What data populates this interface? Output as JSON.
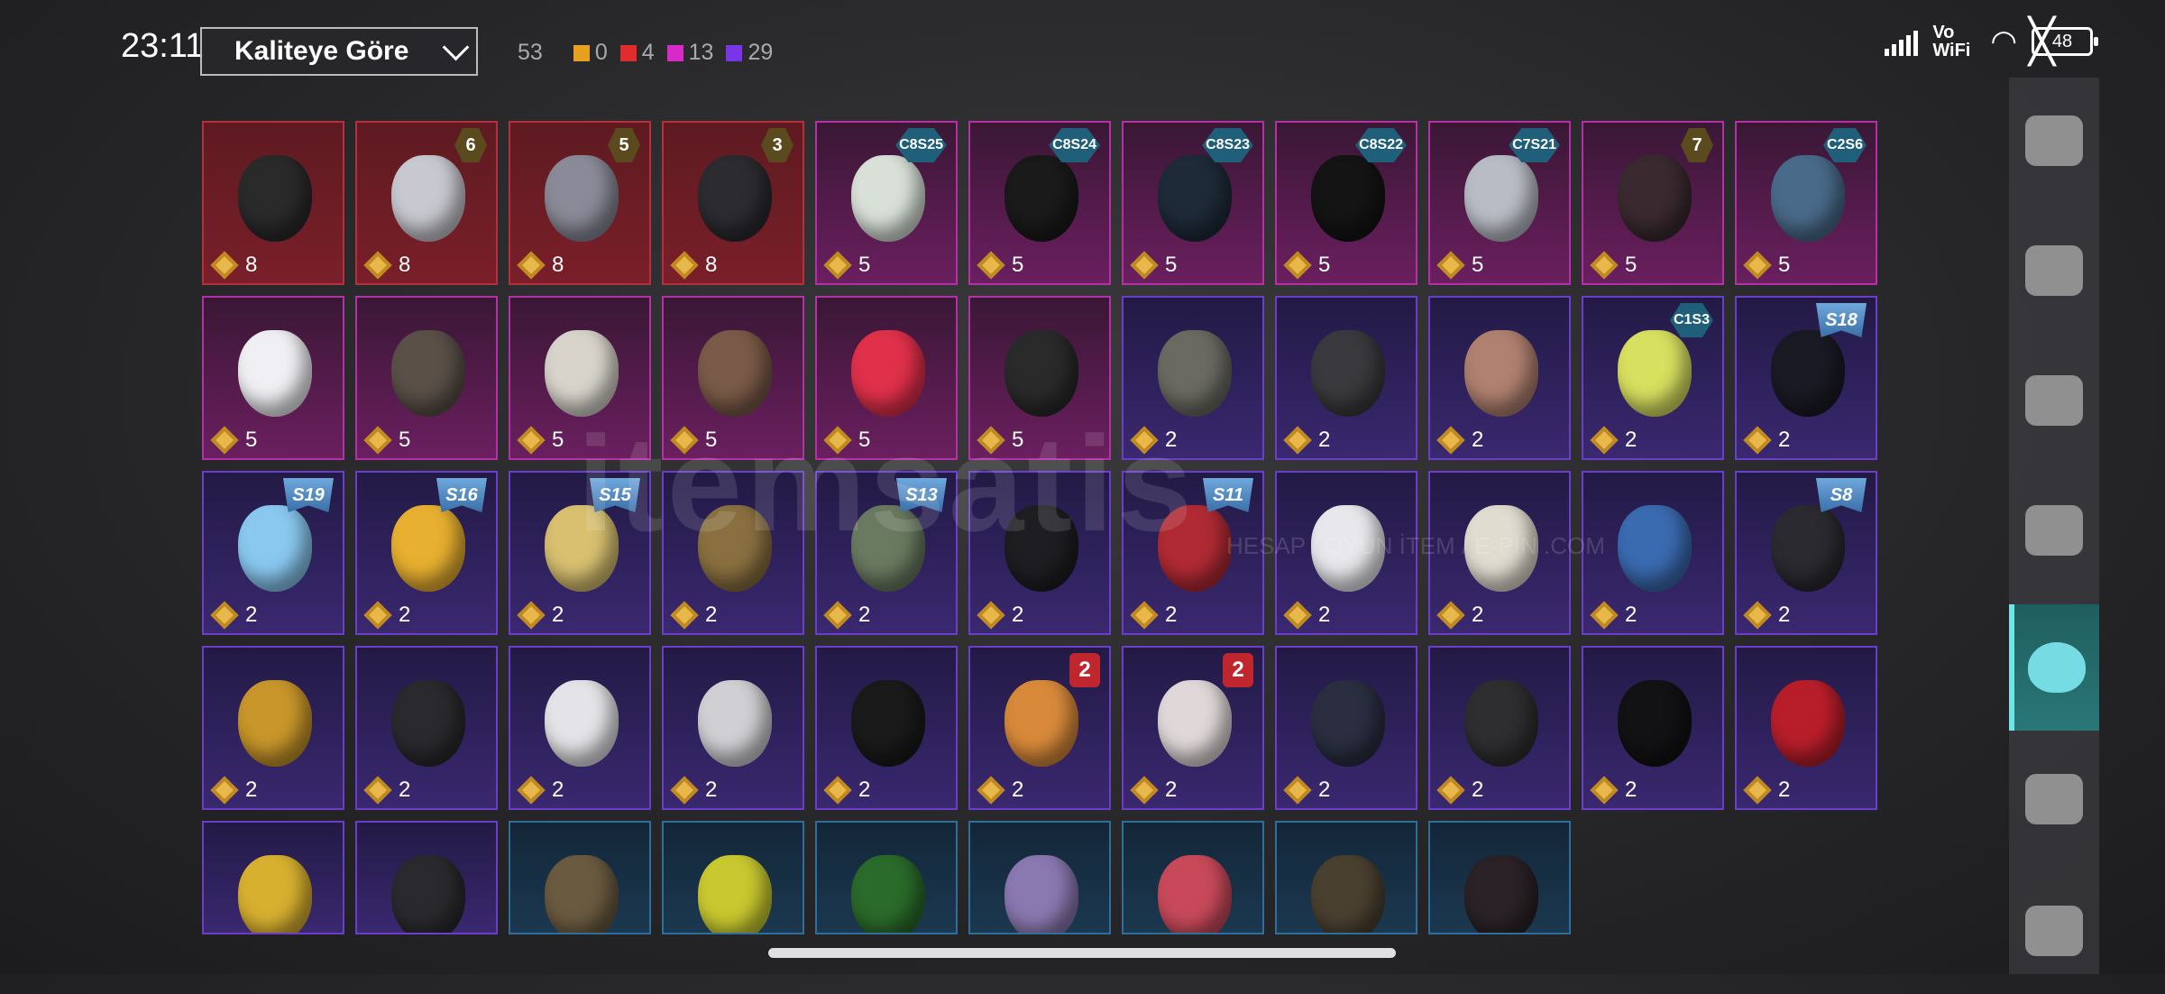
{
  "status_bar": {
    "time": "23:11",
    "network": "Vo WiFi",
    "battery": "48"
  },
  "sort": {
    "label": "Kaliteye Göre"
  },
  "counts": {
    "total": "53",
    "items": [
      {
        "color": "#e8a021",
        "value": "0"
      },
      {
        "color": "#e02c2c",
        "value": "4"
      },
      {
        "color": "#d62bc8",
        "value": "13"
      },
      {
        "color": "#7a35e8",
        "value": "29"
      }
    ]
  },
  "watermark": {
    "main": "itemsatis",
    "sub": "HESAP / OYUN İTEM / E-PIN .COM"
  },
  "items": [
    {
      "rarity": "red",
      "value": "8",
      "badge": "",
      "badge_type": "",
      "icon": "cyber-mask-icon",
      "color": "#2a2a2a"
    },
    {
      "rarity": "red",
      "value": "8",
      "badge": "6",
      "badge_type": "lvl",
      "icon": "plague-doctor-mask-icon",
      "color": "#c8c8d0"
    },
    {
      "rarity": "red",
      "value": "8",
      "badge": "5",
      "badge_type": "lvl",
      "icon": "gas-mask-icon",
      "color": "#8a8a98"
    },
    {
      "rarity": "red",
      "value": "8",
      "badge": "3",
      "badge_type": "lvl",
      "icon": "wolf-mask-icon",
      "color": "#2b2b30"
    },
    {
      "rarity": "pink",
      "value": "5",
      "badge": "C8S25",
      "badge_type": "season",
      "icon": "book-mask-icon",
      "color": "#d8e0d8"
    },
    {
      "rarity": "pink",
      "value": "5",
      "badge": "C8S24",
      "badge_type": "season",
      "icon": "yellow-goggles-icon",
      "color": "#1a1a1a"
    },
    {
      "rarity": "pink",
      "value": "5",
      "badge": "C8S23",
      "badge_type": "season",
      "icon": "neon-face-mask-icon",
      "color": "#1e2a38"
    },
    {
      "rarity": "pink",
      "value": "5",
      "badge": "C8S22",
      "badge_type": "season",
      "icon": "black-face-mask-icon",
      "color": "#141414"
    },
    {
      "rarity": "pink",
      "value": "5",
      "badge": "C7S21",
      "badge_type": "season",
      "icon": "robot-mask-icon",
      "color": "#b8bcc4"
    },
    {
      "rarity": "pink",
      "value": "5",
      "badge": "7",
      "badge_type": "lvl",
      "icon": "wire-mask-icon",
      "color": "#3a2a30"
    },
    {
      "rarity": "pink",
      "value": "5",
      "badge": "C2S6",
      "badge_type": "season",
      "icon": "camo-mask-icon",
      "color": "#4a6a8a"
    },
    {
      "rarity": "pink",
      "value": "5",
      "badge": "",
      "badge_type": "",
      "icon": "clown-mask-icon",
      "color": "#f0f0f4"
    },
    {
      "rarity": "pink",
      "value": "5",
      "badge": "",
      "badge_type": "",
      "icon": "horned-respirator-icon",
      "color": "#5a5048"
    },
    {
      "rarity": "pink",
      "value": "5",
      "badge": "",
      "badge_type": "",
      "icon": "skull-mask-icon",
      "color": "#d8d4cc"
    },
    {
      "rarity": "pink",
      "value": "5",
      "badge": "",
      "badge_type": "",
      "icon": "bird-mask-icon",
      "color": "#7a5a48"
    },
    {
      "rarity": "pink",
      "value": "5",
      "badge": "",
      "badge_type": "",
      "icon": "clown-nose-icon",
      "color": "#e0304a"
    },
    {
      "rarity": "pink",
      "value": "5",
      "badge": "",
      "badge_type": "",
      "icon": "bandana-icon",
      "color": "#2a2a2a"
    },
    {
      "rarity": "purple",
      "value": "2",
      "badge": "",
      "badge_type": "",
      "icon": "hockey-mask-icon",
      "color": "#6a6a62"
    },
    {
      "rarity": "purple",
      "value": "2",
      "badge": "",
      "badge_type": "",
      "icon": "red-eye-visor-icon",
      "color": "#3a3a3e"
    },
    {
      "rarity": "purple",
      "value": "2",
      "badge": "",
      "badge_type": "",
      "icon": "mammoth-mask-icon",
      "color": "#b08070"
    },
    {
      "rarity": "purple",
      "value": "2",
      "badge": "C1S3",
      "badge_type": "season",
      "icon": "green-cross-mask-icon",
      "color": "#d8e060"
    },
    {
      "rarity": "purple",
      "value": "2",
      "badge": "S18",
      "badge_type": "s",
      "icon": "neon-black-mask-icon",
      "color": "#1a1a24"
    },
    {
      "rarity": "purple",
      "value": "2",
      "badge": "S19",
      "badge_type": "s",
      "icon": "crystal-visor-icon",
      "color": "#8ac8f0"
    },
    {
      "rarity": "purple",
      "value": "2",
      "badge": "S16",
      "badge_type": "s",
      "icon": "yellow-respirator-icon",
      "color": "#e8b030"
    },
    {
      "rarity": "purple",
      "value": "2",
      "badge": "S15",
      "badge_type": "s",
      "icon": "gold-skull-mask-icon",
      "color": "#d8c070"
    },
    {
      "rarity": "purple",
      "value": "2",
      "badge": "",
      "badge_type": "",
      "icon": "brass-mask-icon",
      "color": "#8a7040"
    },
    {
      "rarity": "purple",
      "value": "2",
      "badge": "S13",
      "badge_type": "s",
      "icon": "pilot-goggles-icon",
      "color": "#6a7a60"
    },
    {
      "rarity": "purple",
      "value": "2",
      "badge": "",
      "badge_type": "",
      "icon": "black-half-mask-icon",
      "color": "#1e1e22"
    },
    {
      "rarity": "purple",
      "value": "2",
      "badge": "S11",
      "badge_type": "s",
      "icon": "red-half-mask-icon",
      "color": "#b02a34"
    },
    {
      "rarity": "purple",
      "value": "2",
      "badge": "",
      "badge_type": "",
      "icon": "clown-face-icon",
      "color": "#e8e8ec"
    },
    {
      "rarity": "purple",
      "value": "2",
      "badge": "",
      "badge_type": "",
      "icon": "white-bandana-icon",
      "color": "#e0dcd0"
    },
    {
      "rarity": "purple",
      "value": "2",
      "badge": "",
      "badge_type": "",
      "icon": "blue-bandana-icon",
      "color": "#3a6ab0"
    },
    {
      "rarity": "purple",
      "value": "2",
      "badge": "S8",
      "badge_type": "s",
      "icon": "flame-bandana-icon",
      "color": "#2a2a30"
    },
    {
      "rarity": "purple",
      "value": "2",
      "badge": "",
      "badge_type": "",
      "icon": "studded-mask-icon",
      "color": "#c8962a"
    },
    {
      "rarity": "purple",
      "value": "2",
      "badge": "",
      "badge_type": "",
      "icon": "black-full-mask-icon",
      "color": "#2a2a2e"
    },
    {
      "rarity": "purple",
      "value": "2",
      "badge": "",
      "badge_type": "",
      "icon": "white-fur-mask-icon",
      "color": "#e4e4e8"
    },
    {
      "rarity": "purple",
      "value": "2",
      "badge": "",
      "badge_type": "",
      "icon": "skull-face-mask-icon",
      "color": "#d0d0d4"
    },
    {
      "rarity": "purple",
      "value": "2",
      "badge": "",
      "badge_type": "",
      "icon": "teeth-mask-icon",
      "color": "#1a1a1a"
    },
    {
      "rarity": "purple",
      "value": "2",
      "badge": "2",
      "badge_type": "up",
      "icon": "orange-skull-mask-icon",
      "color": "#d88a3a"
    },
    {
      "rarity": "purple",
      "value": "2",
      "badge": "2",
      "badge_type": "up",
      "icon": "clown-payday-mask-icon",
      "color": "#e0d8d8"
    },
    {
      "rarity": "purple",
      "value": "2",
      "badge": "",
      "badge_type": "",
      "icon": "dark-skull-mask-icon",
      "color": "#2a2e40"
    },
    {
      "rarity": "purple",
      "value": "2",
      "badge": "",
      "badge_type": "",
      "icon": "tactical-mask-icon",
      "color": "#2e2e30"
    },
    {
      "rarity": "purple",
      "value": "2",
      "badge": "",
      "badge_type": "",
      "icon": "black-bandana-icon",
      "color": "#121214"
    },
    {
      "rarity": "purple",
      "value": "2",
      "badge": "",
      "badge_type": "",
      "icon": "red-scarf-icon",
      "color": "#b81e2a"
    },
    {
      "rarity": "purple",
      "value": "",
      "badge": "",
      "badge_type": "",
      "icon": "gold-glitter-mask-icon",
      "color": "#d8b030"
    },
    {
      "rarity": "purple",
      "value": "",
      "badge": "",
      "badge_type": "",
      "icon": "black-visor-mask-icon",
      "color": "#2a2a2e"
    },
    {
      "rarity": "blue",
      "value": "",
      "badge": "",
      "badge_type": "",
      "icon": "sack-mask-icon",
      "color": "#6a5a40"
    },
    {
      "rarity": "blue",
      "value": "",
      "badge": "",
      "badge_type": "",
      "icon": "mesh-mask-icon",
      "color": "#c8c830"
    },
    {
      "rarity": "blue",
      "value": "",
      "badge": "",
      "badge_type": "",
      "icon": "web-mask-icon",
      "color": "#2a6a2a"
    },
    {
      "rarity": "blue",
      "value": "",
      "badge": "",
      "badge_type": "",
      "icon": "purple-theater-mask-icon",
      "color": "#8a78b0"
    },
    {
      "rarity": "blue",
      "value": "",
      "badge": "",
      "badge_type": "",
      "icon": "red-theater-mask-icon",
      "color": "#c84a5a"
    },
    {
      "rarity": "blue",
      "value": "",
      "badge": "",
      "badge_type": "",
      "icon": "patterned-face-mask-icon",
      "color": "#4a4030"
    },
    {
      "rarity": "blue",
      "value": "",
      "badge": "",
      "badge_type": "",
      "icon": "dark-respirator-icon",
      "color": "#2a2226"
    }
  ],
  "categories": [
    {
      "icon": "outfit-icon",
      "active": false
    },
    {
      "icon": "helmet-icon",
      "active": false
    },
    {
      "icon": "cap-icon",
      "active": false
    },
    {
      "icon": "glasses-icon",
      "active": false
    },
    {
      "icon": "mask-icon",
      "active": true
    },
    {
      "icon": "jacket-icon",
      "active": false
    },
    {
      "icon": "backpack-icon",
      "active": false
    }
  ]
}
